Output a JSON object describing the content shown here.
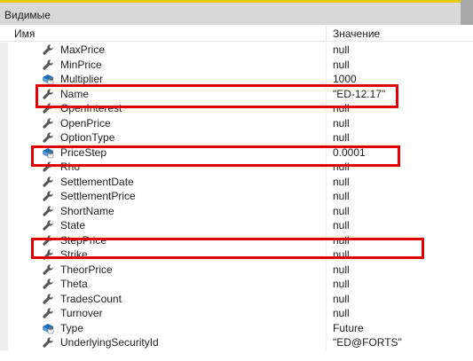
{
  "panel": {
    "title": "Видимые"
  },
  "columns": {
    "name": "Имя",
    "value": "Значение"
  },
  "rows": [
    {
      "name": "MaxPrice",
      "value": "null",
      "icon": "wrench-icon"
    },
    {
      "name": "MinPrice",
      "value": "null",
      "icon": "wrench-icon"
    },
    {
      "name": "Multiplier",
      "value": "1000",
      "icon": "property-icon"
    },
    {
      "name": "Name",
      "value": "\"ED-12.17\"",
      "icon": "wrench-icon"
    },
    {
      "name": "OpenInterest",
      "value": "null",
      "icon": "wrench-icon"
    },
    {
      "name": "OpenPrice",
      "value": "null",
      "icon": "wrench-icon"
    },
    {
      "name": "OptionType",
      "value": "null",
      "icon": "wrench-icon"
    },
    {
      "name": "PriceStep",
      "value": "0.0001",
      "icon": "property-icon"
    },
    {
      "name": "Rho",
      "value": "null",
      "icon": "wrench-icon"
    },
    {
      "name": "SettlementDate",
      "value": "null",
      "icon": "wrench-icon"
    },
    {
      "name": "SettlementPrice",
      "value": "null",
      "icon": "wrench-icon"
    },
    {
      "name": "ShortName",
      "value": "null",
      "icon": "wrench-icon"
    },
    {
      "name": "State",
      "value": "null",
      "icon": "wrench-icon"
    },
    {
      "name": "StepPrice",
      "value": "null",
      "icon": "wrench-icon"
    },
    {
      "name": "Strike",
      "value": "null",
      "icon": "wrench-icon"
    },
    {
      "name": "TheorPrice",
      "value": "null",
      "icon": "wrench-icon"
    },
    {
      "name": "Theta",
      "value": "null",
      "icon": "wrench-icon"
    },
    {
      "name": "TradesCount",
      "value": "null",
      "icon": "wrench-icon"
    },
    {
      "name": "Turnover",
      "value": "null",
      "icon": "wrench-icon"
    },
    {
      "name": "Type",
      "value": "Future",
      "icon": "property-icon"
    },
    {
      "name": "UnderlyingSecurityId",
      "value": "\"ED@FORTS\"",
      "icon": "wrench-icon"
    }
  ],
  "colors": {
    "highlight": "#e00000",
    "accent": "#e8c800",
    "wrench": "#555555",
    "property_icon": "#1f6fb5"
  }
}
